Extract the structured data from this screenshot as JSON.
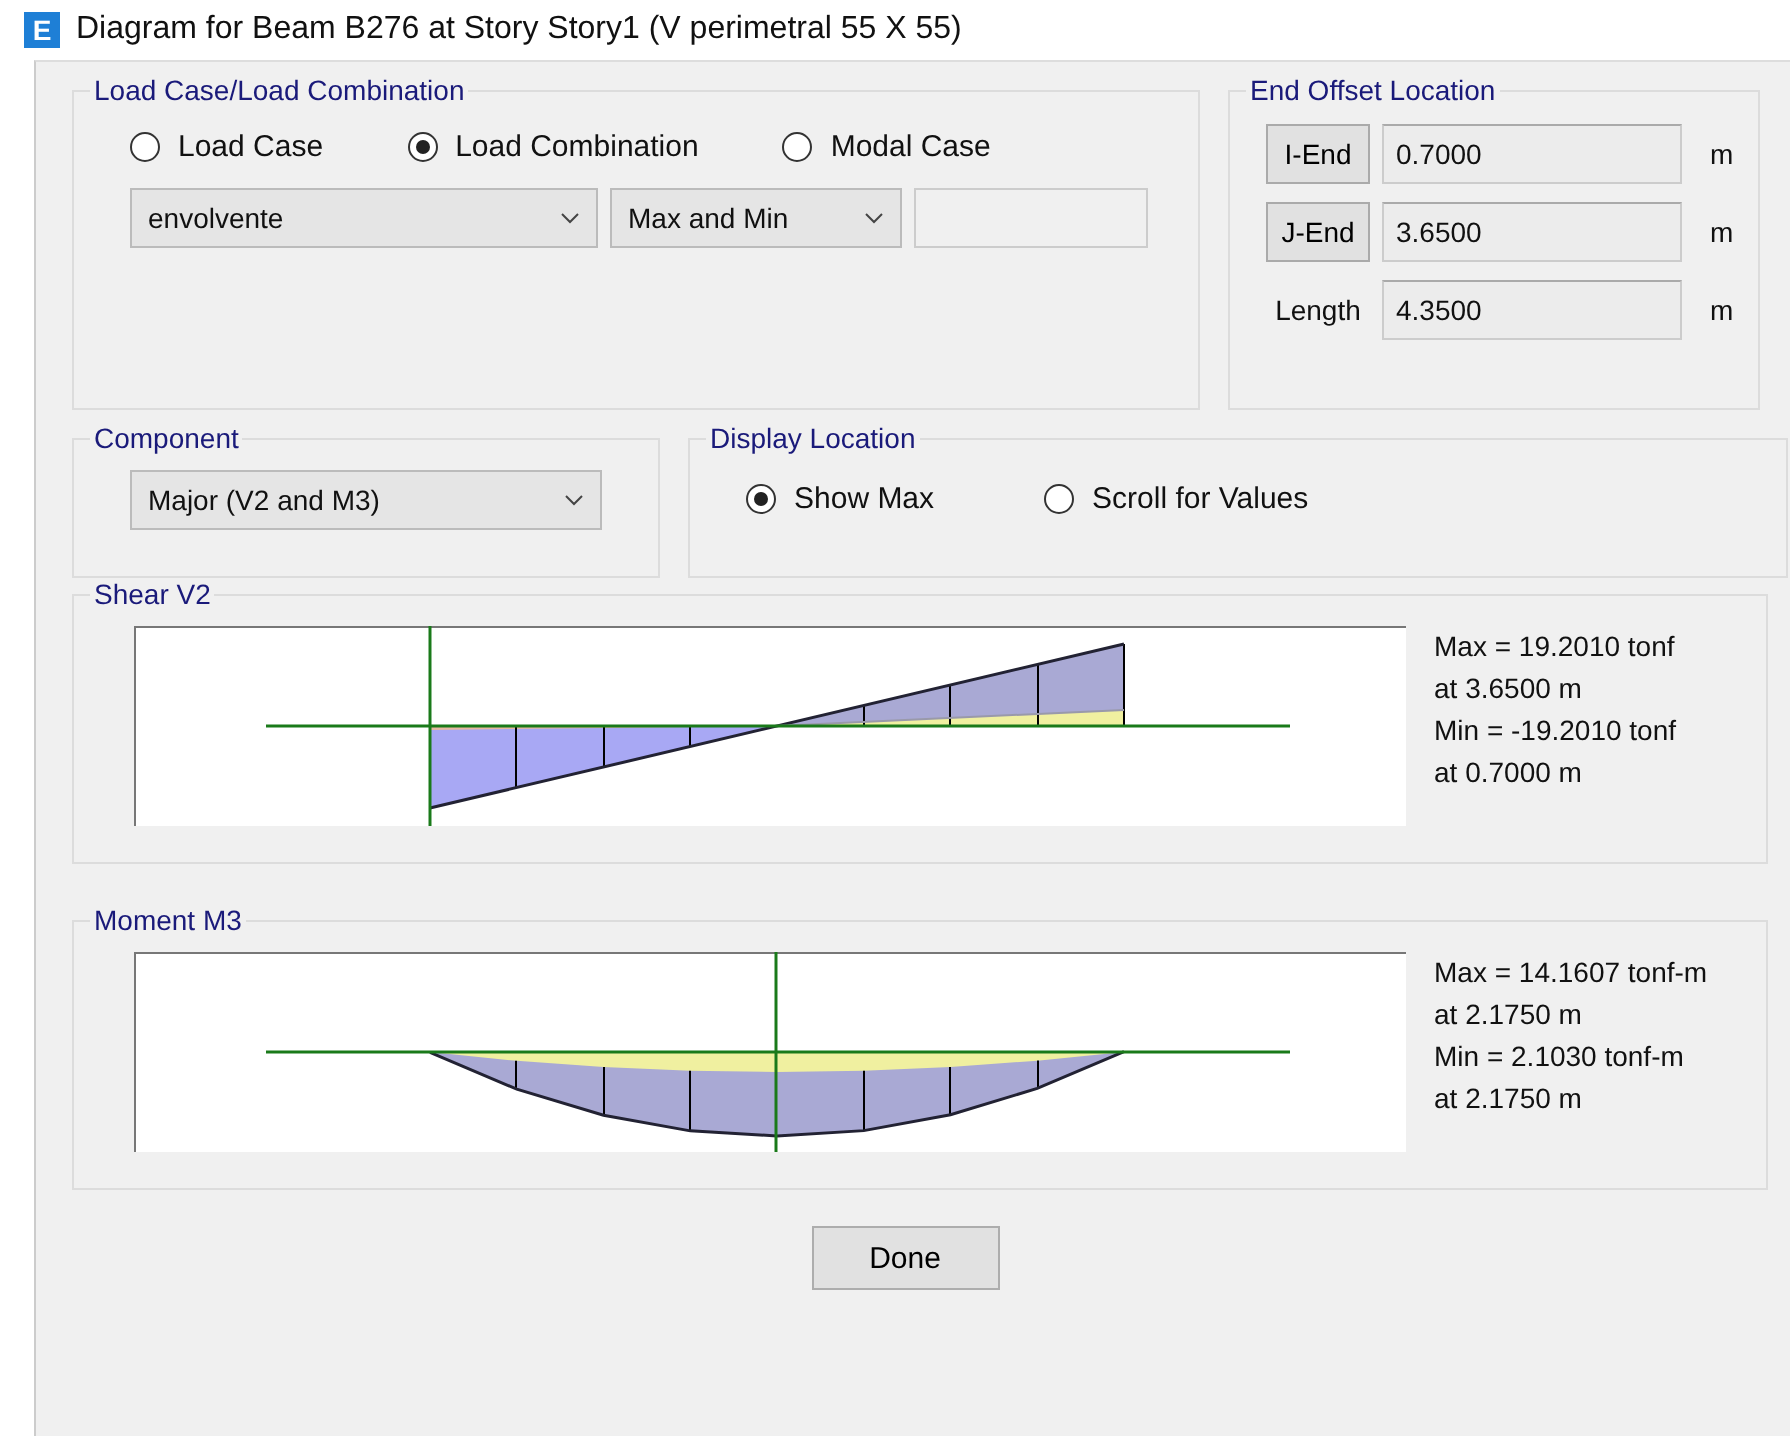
{
  "window": {
    "icon_letter": "E",
    "title": "Diagram for Beam B276 at Story Story1 (V perimetral  55 X 55)"
  },
  "load_case": {
    "title": "Load Case/Load Combination",
    "options": [
      {
        "label": "Load Case",
        "selected": false
      },
      {
        "label": "Load Combination",
        "selected": true
      },
      {
        "label": "Modal Case",
        "selected": false
      }
    ],
    "case_dropdown": "envolvente",
    "type_dropdown": "Max and Min"
  },
  "end_offset": {
    "title": "End Offset Location",
    "rows": [
      {
        "kind": "button",
        "label": "I-End",
        "value": "0.7000",
        "unit": "m"
      },
      {
        "kind": "button",
        "label": "J-End",
        "value": "3.6500",
        "unit": "m"
      },
      {
        "kind": "label",
        "label": "Length",
        "value": "4.3500",
        "unit": "m"
      }
    ]
  },
  "component": {
    "title": "Component",
    "dropdown": "Major (V2 and M3)"
  },
  "display_location": {
    "title": "Display Location",
    "options": [
      {
        "label": "Show Max",
        "selected": true
      },
      {
        "label": "Scroll for Values",
        "selected": false
      }
    ]
  },
  "diagrams": [
    {
      "kind": "shear",
      "title": "Shear V2",
      "results": [
        "Max = 19.2010 tonf",
        "at 3.6500 m",
        "Min = -19.2010 tonf",
        "at 0.7000 m"
      ]
    },
    {
      "kind": "moment",
      "title": "Moment M3",
      "results": [
        "Max = 14.1607 tonf-m",
        "at 2.1750 m",
        "Min = 2.1030 tonf-m",
        "at 2.1750 m"
      ]
    }
  ],
  "buttons": [
    "Done"
  ]
}
